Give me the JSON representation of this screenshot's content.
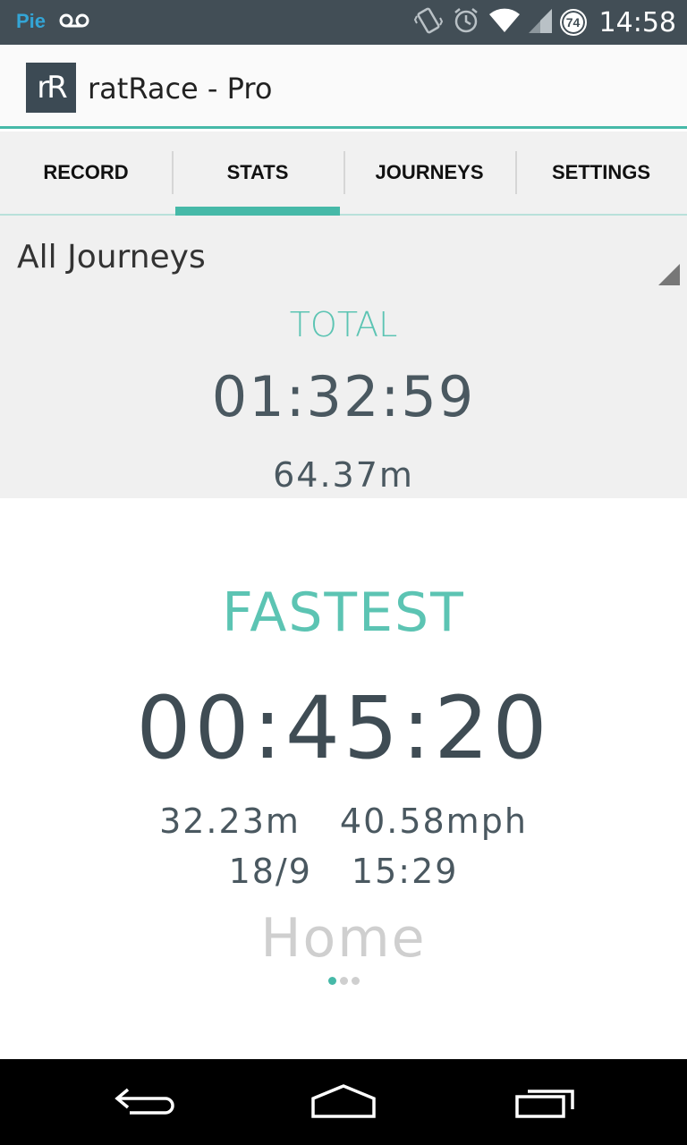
{
  "status_bar": {
    "carrier": "Pie",
    "battery_level": "74",
    "time": "14:58",
    "icons": [
      "voicemail-icon",
      "vibrate-icon",
      "alarm-icon",
      "wifi-icon",
      "signal-icon",
      "battery-icon"
    ]
  },
  "app_bar": {
    "logo_text": "rR",
    "title": "ratRace - Pro"
  },
  "tabs": [
    {
      "label": "RECORD",
      "active": false
    },
    {
      "label": "STATS",
      "active": true
    },
    {
      "label": "JOURNEYS",
      "active": false
    },
    {
      "label": "SETTINGS",
      "active": false
    }
  ],
  "journey_filter": {
    "selected": "All Journeys"
  },
  "total": {
    "heading": "TOTAL",
    "time": "01:32:59",
    "distance": "64.37m"
  },
  "fastest": {
    "heading": "FASTEST",
    "time": "00:45:20",
    "distance": "32.23m",
    "speed": "40.58mph",
    "date": "18/9",
    "start_time": "15:29",
    "journey_name": "Home"
  },
  "pager": {
    "count": 3,
    "active_index": 0
  },
  "colors": {
    "accent": "#46b9a8",
    "status_bar": "#424e56",
    "text_dark": "#3f4c54"
  }
}
